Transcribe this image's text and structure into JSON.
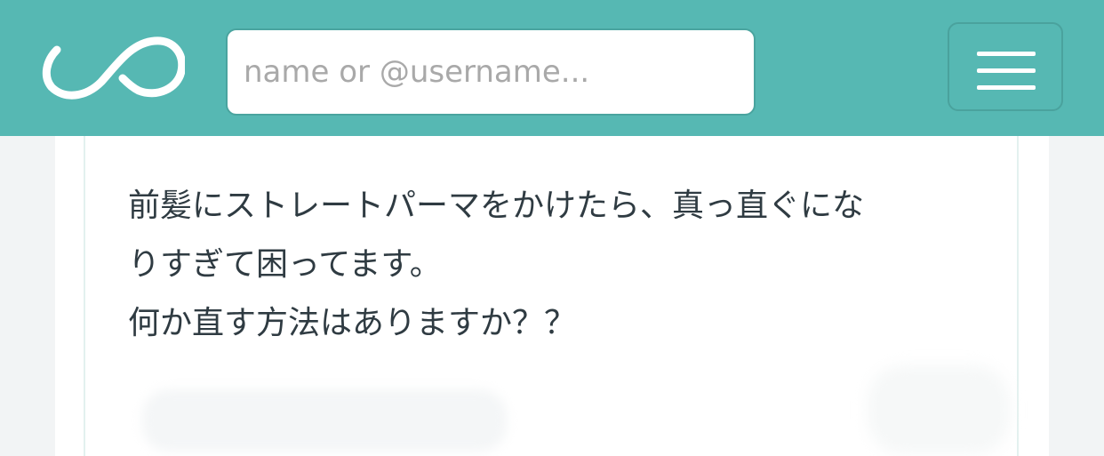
{
  "colors": {
    "accent": "#56b8b3"
  },
  "header": {
    "logo_icon": "infinity-logo-icon",
    "search": {
      "value": "",
      "placeholder": "name or @username..."
    },
    "menu_icon": "hamburger-menu-icon"
  },
  "post": {
    "lines": [
      "前髪にストレートパーマをかけたら、真っ直ぐにな",
      "りすぎて困ってます。",
      "何か直す方法はありますか？？"
    ]
  }
}
